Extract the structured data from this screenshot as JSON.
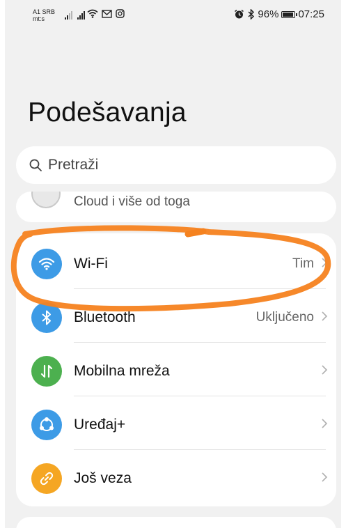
{
  "status_bar": {
    "carrier_line1": "A1 SRB",
    "carrier_line2": "mt:s",
    "battery": "96%",
    "time": "07:25",
    "icons": [
      "signal-icon",
      "signal-icon",
      "wifi-icon",
      "gmail-icon",
      "instagram-icon",
      "alarm-icon",
      "bluetooth-icon",
      "battery-icon"
    ]
  },
  "title": "Podešavanja",
  "search": {
    "placeholder": "Pretraži"
  },
  "partial_item": {
    "label": "Cloud i više od toga"
  },
  "items": [
    {
      "label": "Wi-Fi",
      "value": "Tim",
      "icon": "wifi-icon",
      "color": "#3d9be6"
    },
    {
      "label": "Bluetooth",
      "value": "Uključeno",
      "icon": "bluetooth-icon",
      "color": "#3d9be6"
    },
    {
      "label": "Mobilna mreža",
      "value": "",
      "icon": "mobile-data-icon",
      "color": "#4cb04f"
    },
    {
      "label": "Uređaj+",
      "value": "",
      "icon": "device-plus-icon",
      "color": "#3d9be6"
    },
    {
      "label": "Još veza",
      "value": "",
      "icon": "link-icon",
      "color": "#f5a623"
    }
  ],
  "annotation": {
    "color": "#f5821f"
  }
}
